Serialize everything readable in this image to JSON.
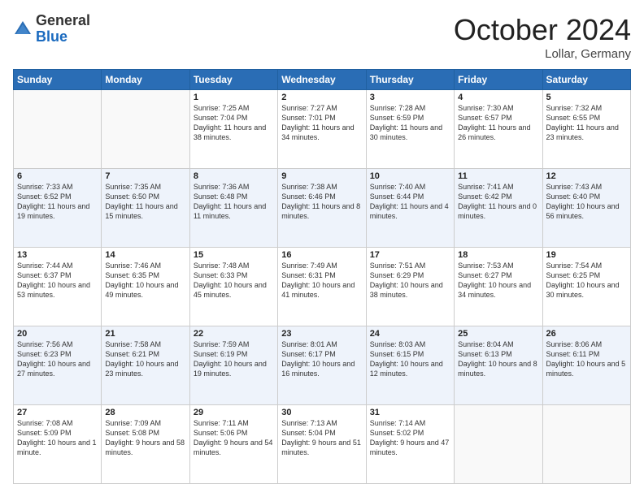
{
  "header": {
    "logo": {
      "general": "General",
      "blue": "Blue"
    },
    "title": "October 2024",
    "location": "Lollar, Germany"
  },
  "days_of_week": [
    "Sunday",
    "Monday",
    "Tuesday",
    "Wednesday",
    "Thursday",
    "Friday",
    "Saturday"
  ],
  "weeks": [
    [
      {
        "day": "",
        "info": ""
      },
      {
        "day": "",
        "info": ""
      },
      {
        "day": "1",
        "info": "Sunrise: 7:25 AM\nSunset: 7:04 PM\nDaylight: 11 hours and 38 minutes."
      },
      {
        "day": "2",
        "info": "Sunrise: 7:27 AM\nSunset: 7:01 PM\nDaylight: 11 hours and 34 minutes."
      },
      {
        "day": "3",
        "info": "Sunrise: 7:28 AM\nSunset: 6:59 PM\nDaylight: 11 hours and 30 minutes."
      },
      {
        "day": "4",
        "info": "Sunrise: 7:30 AM\nSunset: 6:57 PM\nDaylight: 11 hours and 26 minutes."
      },
      {
        "day": "5",
        "info": "Sunrise: 7:32 AM\nSunset: 6:55 PM\nDaylight: 11 hours and 23 minutes."
      }
    ],
    [
      {
        "day": "6",
        "info": "Sunrise: 7:33 AM\nSunset: 6:52 PM\nDaylight: 11 hours and 19 minutes."
      },
      {
        "day": "7",
        "info": "Sunrise: 7:35 AM\nSunset: 6:50 PM\nDaylight: 11 hours and 15 minutes."
      },
      {
        "day": "8",
        "info": "Sunrise: 7:36 AM\nSunset: 6:48 PM\nDaylight: 11 hours and 11 minutes."
      },
      {
        "day": "9",
        "info": "Sunrise: 7:38 AM\nSunset: 6:46 PM\nDaylight: 11 hours and 8 minutes."
      },
      {
        "day": "10",
        "info": "Sunrise: 7:40 AM\nSunset: 6:44 PM\nDaylight: 11 hours and 4 minutes."
      },
      {
        "day": "11",
        "info": "Sunrise: 7:41 AM\nSunset: 6:42 PM\nDaylight: 11 hours and 0 minutes."
      },
      {
        "day": "12",
        "info": "Sunrise: 7:43 AM\nSunset: 6:40 PM\nDaylight: 10 hours and 56 minutes."
      }
    ],
    [
      {
        "day": "13",
        "info": "Sunrise: 7:44 AM\nSunset: 6:37 PM\nDaylight: 10 hours and 53 minutes."
      },
      {
        "day": "14",
        "info": "Sunrise: 7:46 AM\nSunset: 6:35 PM\nDaylight: 10 hours and 49 minutes."
      },
      {
        "day": "15",
        "info": "Sunrise: 7:48 AM\nSunset: 6:33 PM\nDaylight: 10 hours and 45 minutes."
      },
      {
        "day": "16",
        "info": "Sunrise: 7:49 AM\nSunset: 6:31 PM\nDaylight: 10 hours and 41 minutes."
      },
      {
        "day": "17",
        "info": "Sunrise: 7:51 AM\nSunset: 6:29 PM\nDaylight: 10 hours and 38 minutes."
      },
      {
        "day": "18",
        "info": "Sunrise: 7:53 AM\nSunset: 6:27 PM\nDaylight: 10 hours and 34 minutes."
      },
      {
        "day": "19",
        "info": "Sunrise: 7:54 AM\nSunset: 6:25 PM\nDaylight: 10 hours and 30 minutes."
      }
    ],
    [
      {
        "day": "20",
        "info": "Sunrise: 7:56 AM\nSunset: 6:23 PM\nDaylight: 10 hours and 27 minutes."
      },
      {
        "day": "21",
        "info": "Sunrise: 7:58 AM\nSunset: 6:21 PM\nDaylight: 10 hours and 23 minutes."
      },
      {
        "day": "22",
        "info": "Sunrise: 7:59 AM\nSunset: 6:19 PM\nDaylight: 10 hours and 19 minutes."
      },
      {
        "day": "23",
        "info": "Sunrise: 8:01 AM\nSunset: 6:17 PM\nDaylight: 10 hours and 16 minutes."
      },
      {
        "day": "24",
        "info": "Sunrise: 8:03 AM\nSunset: 6:15 PM\nDaylight: 10 hours and 12 minutes."
      },
      {
        "day": "25",
        "info": "Sunrise: 8:04 AM\nSunset: 6:13 PM\nDaylight: 10 hours and 8 minutes."
      },
      {
        "day": "26",
        "info": "Sunrise: 8:06 AM\nSunset: 6:11 PM\nDaylight: 10 hours and 5 minutes."
      }
    ],
    [
      {
        "day": "27",
        "info": "Sunrise: 7:08 AM\nSunset: 5:09 PM\nDaylight: 10 hours and 1 minute."
      },
      {
        "day": "28",
        "info": "Sunrise: 7:09 AM\nSunset: 5:08 PM\nDaylight: 9 hours and 58 minutes."
      },
      {
        "day": "29",
        "info": "Sunrise: 7:11 AM\nSunset: 5:06 PM\nDaylight: 9 hours and 54 minutes."
      },
      {
        "day": "30",
        "info": "Sunrise: 7:13 AM\nSunset: 5:04 PM\nDaylight: 9 hours and 51 minutes."
      },
      {
        "day": "31",
        "info": "Sunrise: 7:14 AM\nSunset: 5:02 PM\nDaylight: 9 hours and 47 minutes."
      },
      {
        "day": "",
        "info": ""
      },
      {
        "day": "",
        "info": ""
      }
    ]
  ]
}
